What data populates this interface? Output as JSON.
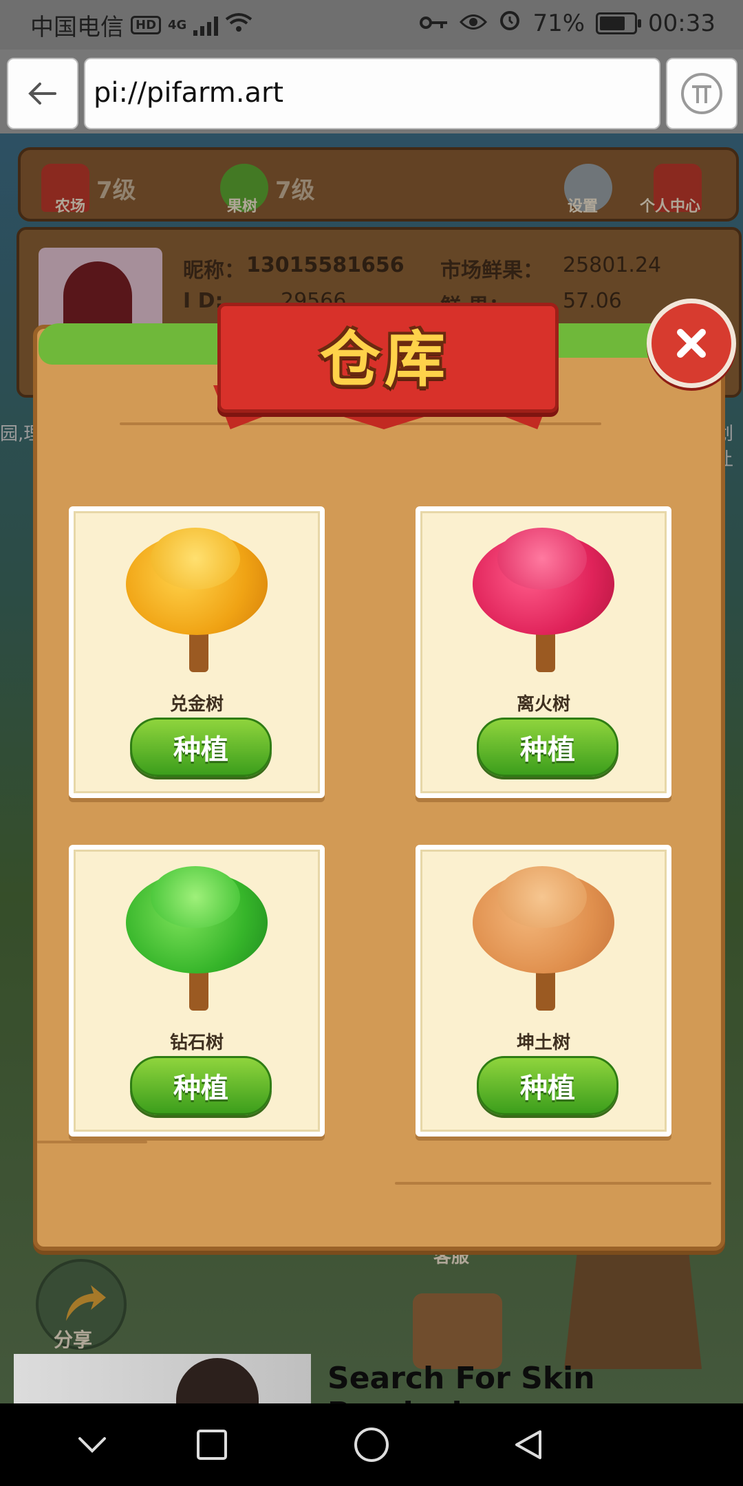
{
  "status_bar": {
    "carrier": "中国电信",
    "hd_badge": "HD",
    "network": "4G",
    "battery": "71%",
    "time": "00:33"
  },
  "browser": {
    "url": "pi://pifarm.art"
  },
  "game_header": {
    "farm_level": "7级",
    "farm_label": "农场",
    "fruit_tree_level": "7级",
    "fruit_tree_label": "果树",
    "settings_label": "设置",
    "personal_center_label": "个人中心"
  },
  "player_info": {
    "nickname_label": "昵称：",
    "nickname": "13015581656",
    "id_label": "I D:",
    "id_value": "29566",
    "market_fruit_label": "市场鲜果：",
    "market_fruit_value": "25801.24",
    "fruit_label": "鲜  果：",
    "fruit_value": "57.06"
  },
  "side_text": {
    "left": "园,理",
    "right": "划让"
  },
  "warehouse_modal": {
    "title": "仓库",
    "items": [
      {
        "name": "兑金树",
        "action": "种植"
      },
      {
        "name": "离火树",
        "action": "种植"
      },
      {
        "name": "钻石树",
        "action": "种植"
      },
      {
        "name": "坤土树",
        "action": "种植"
      }
    ]
  },
  "bottom_game": {
    "share_label": "分享",
    "service_label": "客服"
  },
  "ad": {
    "text": "Search For Skin Psoriasis"
  },
  "colors": {
    "modal_bg": "#d29a55",
    "banner_red": "#d8312a",
    "plant_green": "#3c9e1c",
    "card_bg": "#fbf0cf"
  }
}
